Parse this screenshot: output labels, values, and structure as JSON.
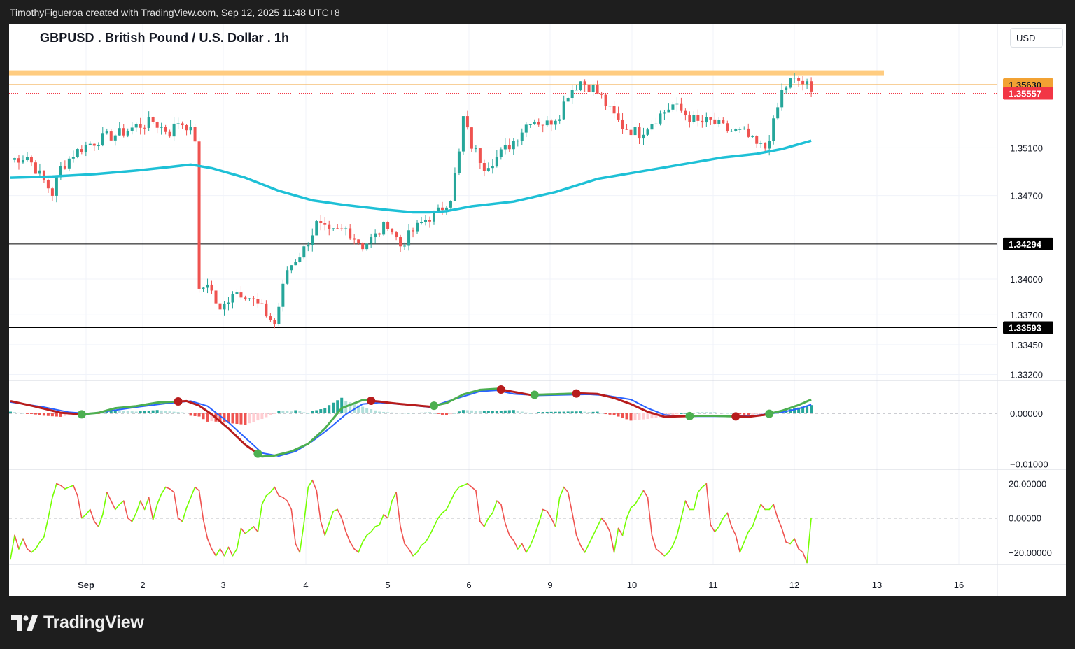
{
  "header": {
    "credit": "TimothyFigueroa created with TradingView.com, Sep 12, 2025 11:48 UTC+8"
  },
  "title": "GBPUSD . British Pound / U.S. Dollar . 1h",
  "currency_button": "USD",
  "brand": "TradingView",
  "colors": {
    "up": "#26a69a",
    "down": "#ef5350",
    "ma": "#1ec0d6",
    "resistance_zone": "#ffcc80",
    "resistance_line": "#f2a233",
    "last_price": "#f23645",
    "macd_fast": "#4caf50",
    "macd_slow": "#2962ff",
    "macd_down": "#b71c1c",
    "osc_up": "#76ff03",
    "osc_down": "#ef5350"
  },
  "chart_data": [
    {
      "type": "candlestick",
      "symbol": "GBPUSD",
      "timeframe": "1h",
      "x_labels": [
        "Sep",
        "2",
        "3",
        "4",
        "5",
        "6",
        "9",
        "10",
        "11",
        "12",
        "13",
        "16"
      ],
      "y_ticks": [
        "1.35100",
        "1.34700",
        "1.34000",
        "1.33700",
        "1.33450",
        "1.33200"
      ],
      "ylim": [
        1.3315,
        1.359
      ],
      "price_labels": [
        {
          "label": "1.35630",
          "value": 1.3563,
          "role": "resistance"
        },
        {
          "label": "1.35557",
          "value": 1.35557,
          "role": "last-price"
        },
        {
          "label": "1.34294",
          "value": 1.34294,
          "role": "level"
        },
        {
          "label": "1.33593",
          "value": 1.33593,
          "role": "level"
        }
      ],
      "resistance_zone": [
        1.3571,
        1.3575
      ],
      "close_path": [
        [
          0,
          1.35
        ],
        [
          4,
          1.3503
        ],
        [
          8,
          1.3482
        ],
        [
          10,
          1.3472
        ],
        [
          12,
          1.3493
        ],
        [
          15,
          1.3505
        ],
        [
          18,
          1.3512
        ],
        [
          22,
          1.3518
        ],
        [
          26,
          1.3522
        ],
        [
          30,
          1.3528
        ],
        [
          34,
          1.3532
        ],
        [
          36,
          1.3527
        ],
        [
          38,
          1.3523
        ],
        [
          40,
          1.3532
        ],
        [
          42,
          1.3529
        ],
        [
          44,
          1.3518
        ],
        [
          45,
          1.3388
        ],
        [
          47,
          1.3398
        ],
        [
          50,
          1.3372
        ],
        [
          53,
          1.339
        ],
        [
          56,
          1.3388
        ],
        [
          60,
          1.3375
        ],
        [
          63,
          1.3362
        ],
        [
          66,
          1.3408
        ],
        [
          70,
          1.3425
        ],
        [
          73,
          1.3446
        ],
        [
          76,
          1.3438
        ],
        [
          80,
          1.3442
        ],
        [
          84,
          1.3428
        ],
        [
          87,
          1.3436
        ],
        [
          90,
          1.3447
        ],
        [
          93,
          1.3428
        ],
        [
          96,
          1.344
        ],
        [
          99,
          1.345
        ],
        [
          102,
          1.3456
        ],
        [
          105,
          1.3469
        ],
        [
          107,
          1.3505
        ],
        [
          108,
          1.3535
        ],
        [
          110,
          1.3512
        ],
        [
          113,
          1.3495
        ],
        [
          116,
          1.3502
        ],
        [
          120,
          1.3516
        ],
        [
          124,
          1.3534
        ],
        [
          128,
          1.353
        ],
        [
          131,
          1.3539
        ],
        [
          133,
          1.3556
        ],
        [
          136,
          1.3566
        ],
        [
          139,
          1.356
        ],
        [
          141,
          1.3552
        ],
        [
          143,
          1.3541
        ],
        [
          146,
          1.3528
        ],
        [
          150,
          1.3522
        ],
        [
          154,
          1.3535
        ],
        [
          158,
          1.3546
        ],
        [
          161,
          1.3538
        ],
        [
          164,
          1.3531
        ],
        [
          167,
          1.3532
        ],
        [
          171,
          1.3525
        ],
        [
          175,
          1.3522
        ],
        [
          178,
          1.3512
        ],
        [
          180,
          1.351
        ],
        [
          182,
          1.353
        ],
        [
          184,
          1.3557
        ],
        [
          186,
          1.3566
        ],
        [
          188,
          1.3566
        ],
        [
          190,
          1.3562
        ],
        [
          191,
          1.3555
        ]
      ],
      "moving_average": [
        [
          0,
          1.3485
        ],
        [
          10,
          1.3486
        ],
        [
          20,
          1.3488
        ],
        [
          30,
          1.3491
        ],
        [
          38,
          1.3494
        ],
        [
          43,
          1.3496
        ],
        [
          48,
          1.3493
        ],
        [
          56,
          1.3485
        ],
        [
          64,
          1.3474
        ],
        [
          72,
          1.3466
        ],
        [
          80,
          1.3462
        ],
        [
          90,
          1.3458
        ],
        [
          96,
          1.3456
        ],
        [
          100,
          1.3456
        ],
        [
          104,
          1.3457
        ],
        [
          110,
          1.3461
        ],
        [
          120,
          1.3465
        ],
        [
          130,
          1.3473
        ],
        [
          140,
          1.3484
        ],
        [
          150,
          1.349
        ],
        [
          160,
          1.3496
        ],
        [
          170,
          1.3502
        ],
        [
          178,
          1.3505
        ],
        [
          184,
          1.3509
        ],
        [
          191,
          1.3516
        ]
      ]
    },
    {
      "type": "line",
      "name": "MACD pane",
      "y_ticks": [
        "0.00000",
        "−0.01000"
      ],
      "ylim": [
        -0.011,
        0.0063
      ],
      "fast": [
        [
          0,
          0.0024
        ],
        [
          6,
          0.0013
        ],
        [
          12,
          0.0001
        ],
        [
          17,
          -0.0002
        ],
        [
          21,
          0.0001
        ],
        [
          25,
          0.001
        ],
        [
          30,
          0.0014
        ],
        [
          35,
          0.0021
        ],
        [
          42,
          0.0024
        ],
        [
          45,
          0.0015
        ],
        [
          48,
          -0.0002
        ],
        [
          52,
          -0.003
        ],
        [
          56,
          -0.0062
        ],
        [
          60,
          -0.0085
        ],
        [
          63,
          -0.0083
        ],
        [
          67,
          -0.0075
        ],
        [
          71,
          -0.006
        ],
        [
          75,
          -0.003
        ],
        [
          79,
          0.001
        ],
        [
          84,
          0.0026
        ],
        [
          88,
          0.0023
        ],
        [
          92,
          0.0019
        ],
        [
          96,
          0.0016
        ],
        [
          100,
          0.0013
        ],
        [
          104,
          0.002
        ],
        [
          108,
          0.0037
        ],
        [
          112,
          0.0046
        ],
        [
          116,
          0.0048
        ],
        [
          120,
          0.0042
        ],
        [
          124,
          0.0036
        ],
        [
          128,
          0.0037
        ],
        [
          132,
          0.0038
        ],
        [
          136,
          0.0039
        ],
        [
          140,
          0.0038
        ],
        [
          144,
          0.003
        ],
        [
          148,
          0.0018
        ],
        [
          152,
          0.0003
        ],
        [
          156,
          -0.0007
        ],
        [
          160,
          -0.0006
        ],
        [
          164,
          -0.0005
        ],
        [
          168,
          -0.0005
        ],
        [
          172,
          -0.0006
        ],
        [
          176,
          -0.0007
        ],
        [
          180,
          -0.0003
        ],
        [
          184,
          0.0005
        ],
        [
          188,
          0.0016
        ],
        [
          191,
          0.0027
        ]
      ],
      "slow": [
        [
          0,
          0.0022
        ],
        [
          8,
          0.0012
        ],
        [
          14,
          0.0002
        ],
        [
          19,
          -0.0001
        ],
        [
          24,
          0.0005
        ],
        [
          30,
          0.0012
        ],
        [
          38,
          0.002
        ],
        [
          43,
          0.0024
        ],
        [
          47,
          0.0014
        ],
        [
          52,
          -0.0018
        ],
        [
          56,
          -0.0048
        ],
        [
          60,
          -0.0078
        ],
        [
          64,
          -0.0084
        ],
        [
          68,
          -0.0075
        ],
        [
          72,
          -0.0055
        ],
        [
          76,
          -0.003
        ],
        [
          80,
          -0.0002
        ],
        [
          84,
          0.0018
        ],
        [
          88,
          0.0021
        ],
        [
          94,
          0.0017
        ],
        [
          100,
          0.0012
        ],
        [
          106,
          0.0028
        ],
        [
          112,
          0.0043
        ],
        [
          116,
          0.0045
        ],
        [
          120,
          0.0038
        ],
        [
          126,
          0.0035
        ],
        [
          132,
          0.0036
        ],
        [
          138,
          0.0037
        ],
        [
          142,
          0.0035
        ],
        [
          148,
          0.0027
        ],
        [
          152,
          0.001
        ],
        [
          156,
          -0.0003
        ],
        [
          160,
          -0.0006
        ],
        [
          166,
          -0.0006
        ],
        [
          172,
          -0.0006
        ],
        [
          178,
          -0.0004
        ],
        [
          184,
          0.0002
        ],
        [
          188,
          0.0009
        ],
        [
          191,
          0.0017
        ]
      ],
      "cross_markers": [
        [
          17,
          -0.0002,
          "up"
        ],
        [
          40,
          0.0024,
          "down"
        ],
        [
          59,
          -0.0084,
          "up"
        ],
        [
          86,
          0.0024,
          "down"
        ],
        [
          101,
          0.0013,
          "up"
        ],
        [
          117,
          0.0042,
          "down"
        ],
        [
          125,
          0.0035,
          "up"
        ],
        [
          135,
          0.0039,
          "down"
        ],
        [
          162,
          -0.0006,
          "up"
        ],
        [
          173,
          -0.0005,
          "down"
        ],
        [
          181,
          -0.0006,
          "up"
        ]
      ]
    },
    {
      "type": "line",
      "name": "Oscillator pane",
      "y_ticks": [
        "20.00000",
        "0.00000",
        "−20.00000"
      ],
      "ylim": [
        -27,
        28
      ],
      "values": [
        -24,
        -10,
        -18,
        -12,
        -18,
        -20,
        -18,
        -14,
        -11,
        0,
        12,
        20,
        19,
        17,
        18,
        19,
        13,
        0,
        2,
        5,
        -2,
        -5,
        2,
        15,
        10,
        5,
        8,
        10,
        0,
        -2,
        3,
        10,
        5,
        12,
        -1,
        8,
        14,
        18,
        17,
        15,
        0,
        -2,
        6,
        12,
        18,
        16,
        -1,
        -12,
        -18,
        -22,
        -18,
        -22,
        -17,
        -22,
        -18,
        -6,
        -9,
        -7,
        -5,
        -8,
        8,
        13,
        15,
        18,
        13,
        12,
        10,
        5,
        -15,
        -20,
        -3,
        18,
        22,
        16,
        -2,
        -10,
        -3,
        4,
        5,
        0,
        -8,
        -14,
        -18,
        -20,
        -14,
        -10,
        -8,
        -5,
        -4,
        2,
        0,
        10,
        15,
        -5,
        -15,
        -18,
        -22,
        -20,
        -16,
        -14,
        -10,
        -5,
        0,
        3,
        5,
        10,
        15,
        18,
        19,
        20,
        18,
        16,
        -2,
        -5,
        0,
        3,
        10,
        8,
        -3,
        -10,
        -13,
        -18,
        -15,
        -20,
        -16,
        -10,
        -3,
        5,
        4,
        0,
        -5,
        12,
        18,
        15,
        3,
        -10,
        -16,
        -20,
        -15,
        -10,
        -5,
        0,
        -3,
        -8,
        -20,
        -6,
        -10,
        0,
        6,
        8,
        12,
        16,
        12,
        -10,
        -18,
        -20,
        -22,
        -20,
        -16,
        -10,
        0,
        10,
        5,
        5,
        15,
        18,
        20,
        -4,
        -8,
        -5,
        0,
        3,
        -5,
        -10,
        -20,
        -14,
        -8,
        -5,
        2,
        8,
        5,
        5,
        8,
        0,
        -6,
        -14,
        -15,
        -12,
        -18,
        -20,
        -26,
        0,
        -8,
        12,
        18,
        18,
        13,
        11,
        -6,
        8,
        0,
        -10,
        -20,
        -22
      ]
    }
  ]
}
